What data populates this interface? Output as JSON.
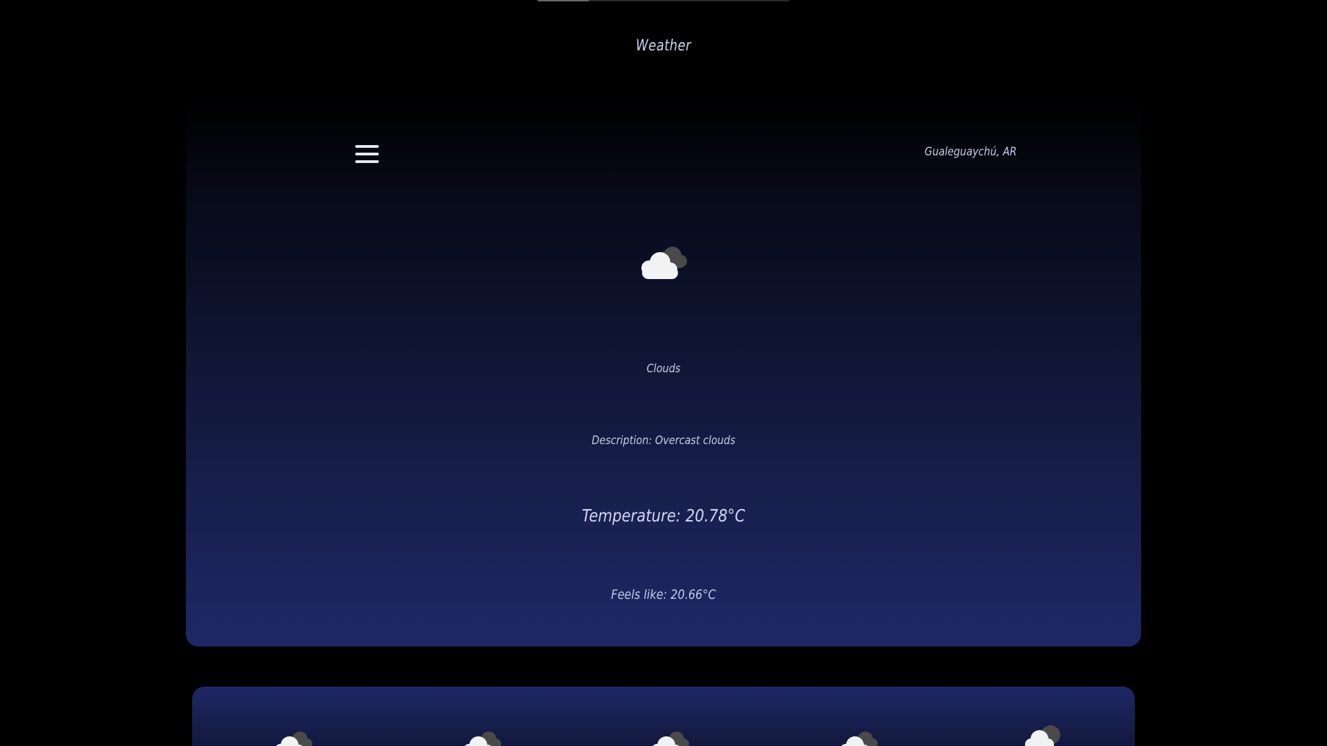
{
  "app": {
    "title": "Weather"
  },
  "header": {
    "menu_icon": "hamburger-menu-icon",
    "location": "Gualeguaychú, AR"
  },
  "current": {
    "icon": "overcast-clouds-icon",
    "condition": "Clouds",
    "description": "Description: Overcast clouds",
    "temperature": "Temperature: 20.78°C",
    "feels_like": "Feels like: 20.66°C"
  },
  "forecast": {
    "items": [
      {
        "icon": "overcast-clouds-icon"
      },
      {
        "icon": "overcast-clouds-icon"
      },
      {
        "icon": "overcast-clouds-icon"
      },
      {
        "icon": "overcast-clouds-icon"
      },
      {
        "icon": "broken-clouds-icon"
      }
    ]
  },
  "colors": {
    "background": "#000000",
    "card_gradient_top": "#000000",
    "card_gradient_bottom": "#1e2866",
    "text": "#c7cbe6",
    "cloud_front": "#f2f2f2",
    "cloud_back": "#4a4a4a"
  }
}
